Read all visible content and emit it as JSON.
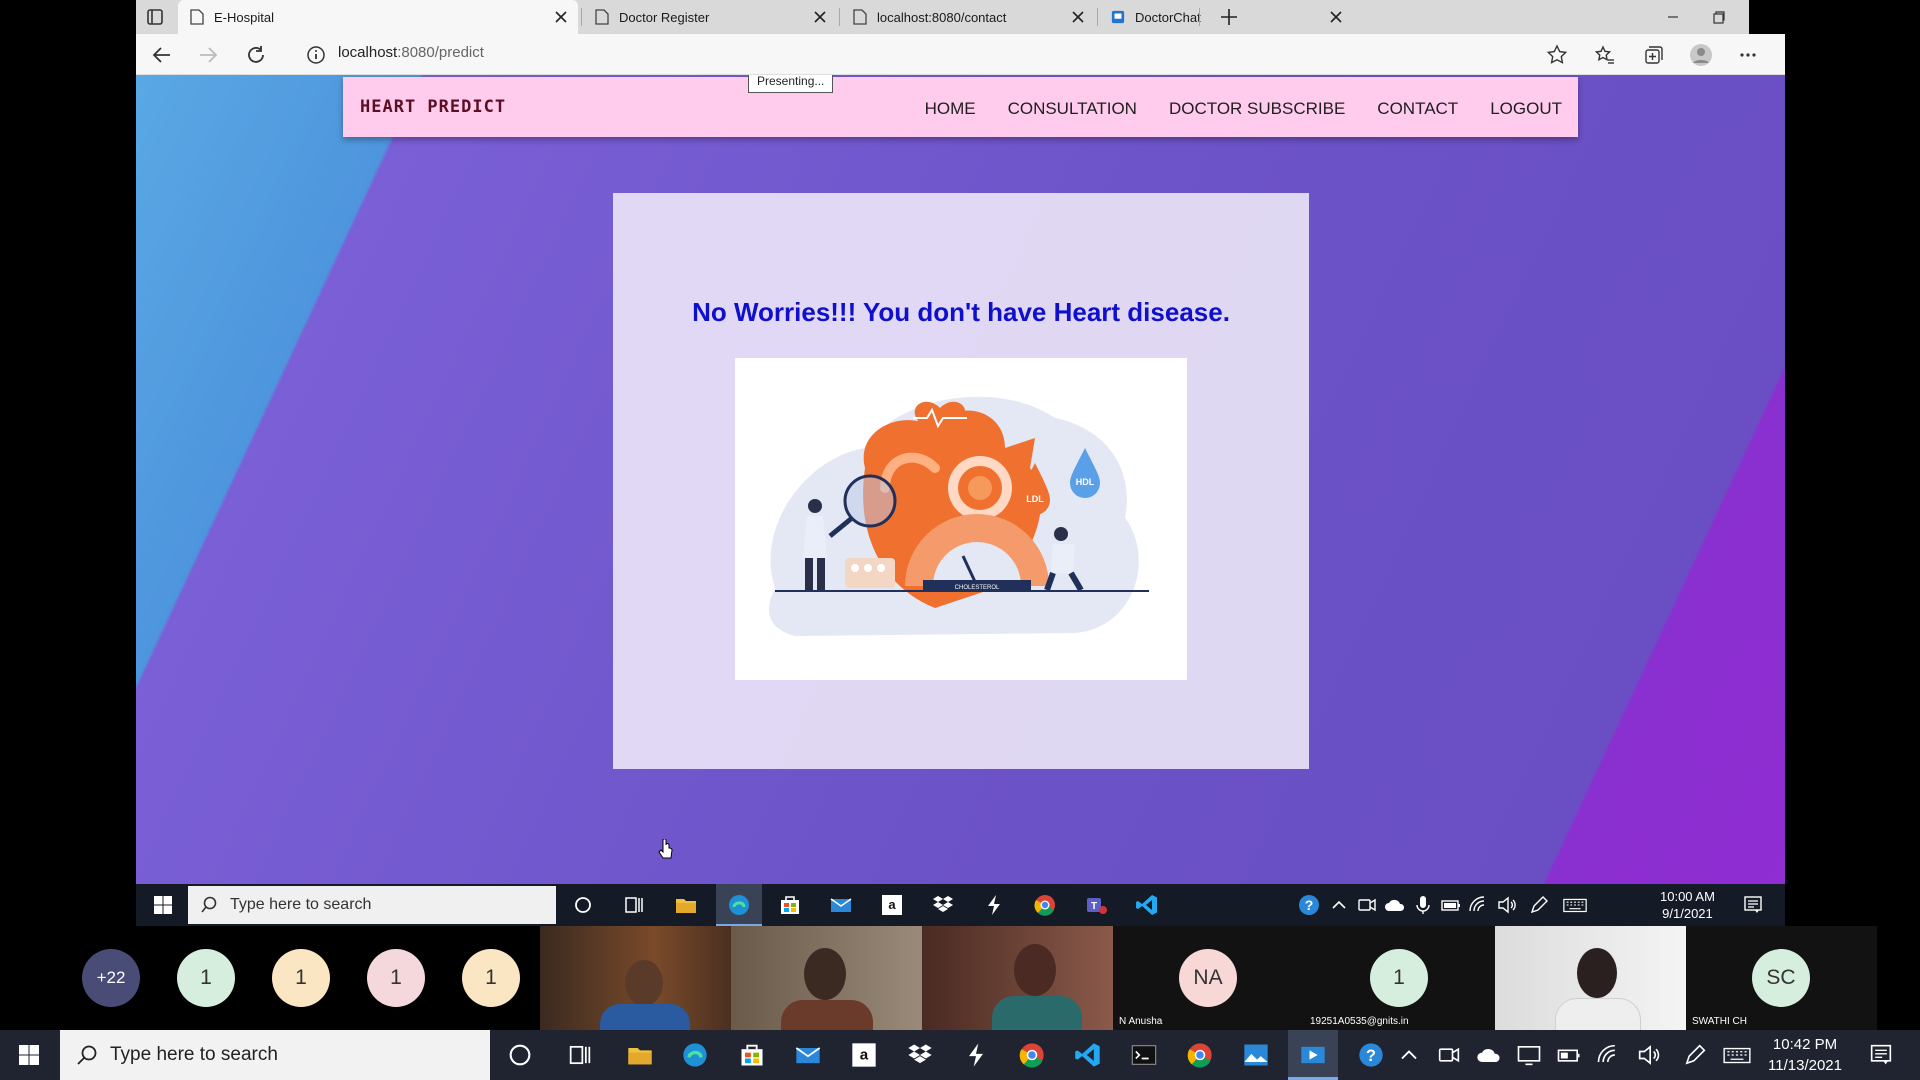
{
  "browser": {
    "tabs": [
      {
        "title": "E-Hospital",
        "active": true
      },
      {
        "title": "Doctor Register",
        "active": false
      },
      {
        "title": "localhost:8080/contact",
        "active": false
      },
      {
        "title": "DoctorChat",
        "active": false
      }
    ],
    "url_host": "localhost",
    "url_path": ":8080/predict"
  },
  "app": {
    "brand": "HEART PREDICT",
    "nav": [
      "HOME",
      "CONSULTATION",
      "DOCTOR SUBSCRIBE",
      "CONTACT",
      "LOGOUT"
    ],
    "presenting_tooltip": "Presenting...",
    "result_message": "No Worries!!! You don't have Heart disease.",
    "illustration_labels": {
      "hdl": "HDL",
      "ldl": "LDL",
      "gauge": "CHOLESTEROL"
    }
  },
  "inner_taskbar": {
    "search_placeholder": "Type here to search",
    "time": "10:00 AM",
    "date": "9/1/2021"
  },
  "participants": {
    "overflow": "+22",
    "avatars": [
      "1",
      "1",
      "1",
      "1"
    ],
    "tiles": [
      {
        "initials": "NA",
        "name": "N Anusha"
      },
      {
        "initials": "1",
        "name": "19251A0535@gnits.in"
      },
      {
        "initials": "SC",
        "name": "SWATHI CH"
      }
    ]
  },
  "taskbar": {
    "search_placeholder": "Type here to search",
    "time": "10:42 PM",
    "date": "11/13/2021"
  },
  "colors": {
    "navbar_bg": "#ffccee",
    "result_text": "#1010cc",
    "heart_orange": "#f07030"
  }
}
